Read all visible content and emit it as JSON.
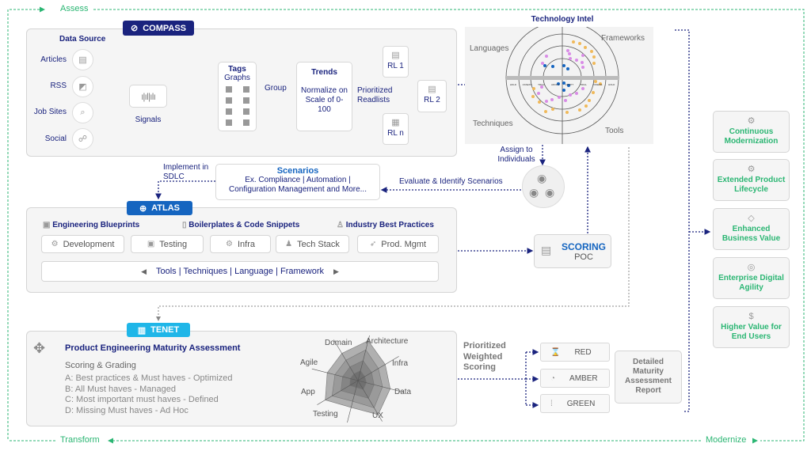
{
  "cycle": {
    "assess": "Assess",
    "transform": "Transform",
    "modernize": "Modernize"
  },
  "compass": {
    "badge": "COMPASS",
    "data_source_title": "Data Source",
    "sources": [
      "Articles",
      "RSS",
      "Job Sites",
      "Social"
    ],
    "signals": "Signals",
    "tags_title": "Tags",
    "tags_sub": "Graphs",
    "group": "Group",
    "trends_title": "Trends",
    "trends_text": "Normalize on Scale of 0-100",
    "prioritized": "Prioritized Readlists",
    "readlists": [
      "RL 1",
      "RL 2",
      "RL n"
    ]
  },
  "tech_intel": {
    "title": "Technology Intel",
    "quadrants": [
      "Languages",
      "Frameworks",
      "Techniques",
      "Tools"
    ],
    "rings": [
      "HOLD",
      "ASSESS",
      "TRIAL",
      "ADOPT",
      "ADOPT",
      "TRIAL",
      "ASSESS",
      "HOLD"
    ],
    "colors": {
      "adopt": "#1565c0",
      "trial": "#d98ce6",
      "assess": "#f0b95a"
    }
  },
  "assign": "Assign to Individuals",
  "evaluate": "Evaluate & Identify Scenarios",
  "implement": "Implement in SDLC",
  "scenarios": {
    "title": "Scenarios",
    "line1": "Ex. Compliance | Automation |",
    "line2": "Configuration Management and More..."
  },
  "atlas": {
    "badge": "ATLAS",
    "headers": [
      "Engineering Blueprints",
      "Boilerplates & Code Snippets",
      "Industry Best Practices"
    ],
    "chips": [
      "Development",
      "Testing",
      "Infra",
      "Tech Stack",
      "Prod. Mgmt"
    ],
    "carousel": "Tools | Techniques | Language | Framework"
  },
  "scoring": {
    "title": "SCORING",
    "sub": "POC"
  },
  "tenet": {
    "badge": "TENET",
    "title": "Product Engineering Maturity  Assessment",
    "scoring_title": "Scoring & Grading",
    "grades": [
      "A: Best practices & Must haves - Optimized",
      "B: All Must haves - Managed",
      "C: Most important must haves - Defined",
      "D: Missing Must haves - Ad Hoc"
    ],
    "radar_axes": [
      "Domain",
      "Architecture",
      "Infra",
      "Data",
      "UX",
      "Testing",
      "App",
      "Agile"
    ]
  },
  "weighted": "Prioritized Weighted Scoring",
  "rag": [
    "RED",
    "AMBER",
    "GREEN"
  ],
  "report": "Detailed Maturity Assessment Report",
  "benefits": [
    "Continuous Modernization",
    "Extended Product Lifecycle",
    "Enhanced Business Value",
    "Enterprise Digital Agility",
    "Higher Value for End Users"
  ],
  "accent": {
    "navy": "#1a237e",
    "blue": "#1565c0",
    "cyan": "#1fb6e8",
    "green": "#2bb673"
  }
}
